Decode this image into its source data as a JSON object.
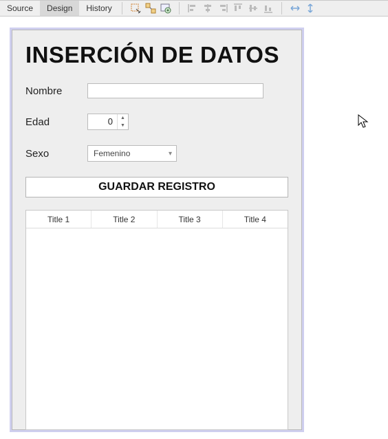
{
  "tabs": {
    "source": "Source",
    "design": "Design",
    "history": "History"
  },
  "form": {
    "title": "INSERCIÓN DE DATOS",
    "nombre_label": "Nombre",
    "nombre_value": "",
    "edad_label": "Edad",
    "edad_value": "0",
    "sexo_label": "Sexo",
    "sexo_value": "Femenino",
    "save_label": "GUARDAR REGISTRO"
  },
  "table": {
    "columns": [
      "Title 1",
      "Title 2",
      "Title 3",
      "Title 4"
    ]
  }
}
